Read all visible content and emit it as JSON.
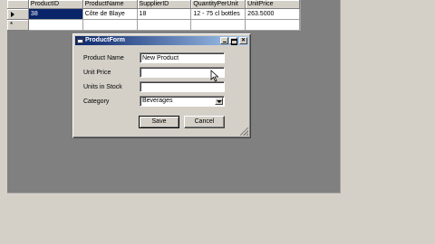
{
  "grid": {
    "columns": [
      "ProductID",
      "ProductName",
      "SupplierID",
      "QuantityPerUnit",
      "UnitPrice"
    ],
    "rows": [
      [
        "38",
        "Côte de Blaye",
        "18",
        "12 - 75 cl bottles",
        "263.5000"
      ]
    ],
    "new_row_marker": "*"
  },
  "dialog": {
    "title": "ProductForm",
    "fields": {
      "product_name_label": "Product Name",
      "product_name_value": "New Product",
      "unit_price_label": "Unit Price",
      "unit_price_value": "",
      "units_in_stock_label": "Units in Stock",
      "units_in_stock_value": "",
      "category_label": "Category",
      "category_value": "Beverages"
    },
    "buttons": {
      "save": "Save",
      "cancel": "Cancel"
    }
  },
  "colors": {
    "selection": "#0a246a",
    "window_face": "#d4d0c8",
    "grid_background": "#808080"
  },
  "icons": {
    "current_row": "row-pointer-icon",
    "cursor": "mouse-pointer-icon"
  }
}
